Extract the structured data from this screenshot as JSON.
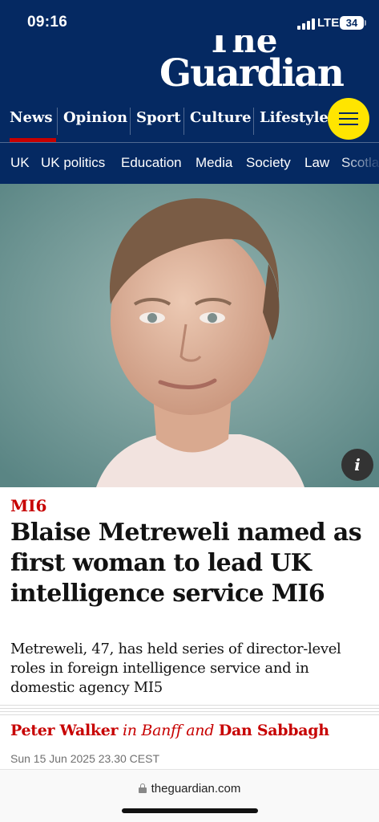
{
  "status_bar": {
    "time": "09:16",
    "network": "LTE",
    "battery": "34"
  },
  "logo": {
    "line1": "The",
    "line2": "Guardian"
  },
  "pillars": [
    {
      "label": "News",
      "active": true
    },
    {
      "label": "Opinion"
    },
    {
      "label": "Sport"
    },
    {
      "label": "Culture"
    },
    {
      "label": "Lifestyle"
    }
  ],
  "subnav": [
    "UK",
    "UK politics",
    "Education",
    "Media",
    "Society",
    "Law",
    "Scotland"
  ],
  "hero": {
    "info_label": "i"
  },
  "article": {
    "kicker": "MI6",
    "headline_lines": [
      "Blaise Metreweli named as",
      "first woman to lead UK",
      "intelligence service MI6"
    ],
    "standfirst_lines": [
      "Metreweli, 47, has held series of director-level",
      "roles in foreign intelligence service and in",
      "domestic agency MI5"
    ],
    "byline": {
      "author1": "Peter Walker",
      "location": " in Banff",
      "conjunction": " and ",
      "author2": "Dan Sabbagh"
    },
    "date": "Sun 15 Jun 2025 23.30 CEST"
  },
  "browser": {
    "url": "theguardian.com"
  },
  "colors": {
    "brand": "#052962",
    "news_red": "#c70000",
    "menu_yellow": "#ffe500"
  }
}
